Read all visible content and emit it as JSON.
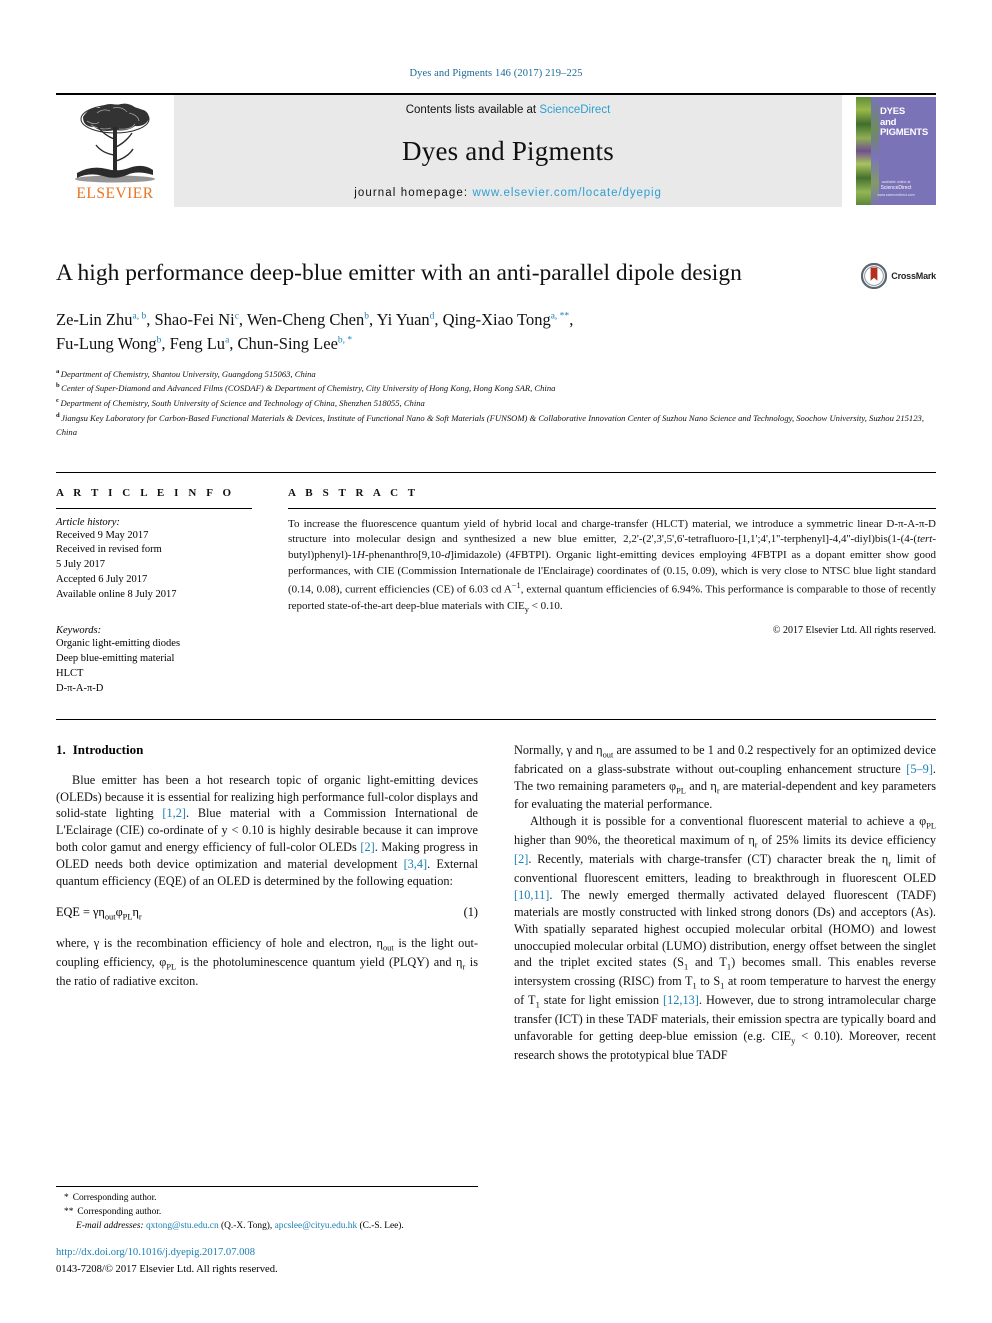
{
  "running_head": "Dyes and Pigments 146 (2017) 219–225",
  "masthead": {
    "publisher": "ELSEVIER",
    "contents_prefix": "Contents lists available at ",
    "contents_link": "ScienceDirect",
    "journal_title": "Dyes and Pigments",
    "homepage_prefix": "journal homepage: ",
    "homepage_url": "www.elsevier.com/locate/dyepig",
    "cover_title_line1": "DYES",
    "cover_title_line2": "and",
    "cover_title_line3": "PIGMENTS",
    "cover_footer_small": "available online at",
    "cover_footer_mark": "ScienceDirect",
    "cover_footer_url": "www.sciencedirect.com"
  },
  "article": {
    "title": "A high performance deep-blue emitter with an anti-parallel dipole design",
    "crossmark_label": "CrossMark"
  },
  "authors": {
    "line1": [
      {
        "name": "Ze-Lin Zhu",
        "marks": "a, b",
        "sep": ", "
      },
      {
        "name": "Shao-Fei Ni",
        "marks": "c",
        "sep": ", "
      },
      {
        "name": "Wen-Cheng Chen",
        "marks": "b",
        "sep": ", "
      },
      {
        "name": "Yi Yuan",
        "marks": "d",
        "sep": ", "
      },
      {
        "name": "Qing-Xiao Tong",
        "marks": "a, **",
        "sep": ","
      }
    ],
    "line2": [
      {
        "name": "Fu-Lung Wong",
        "marks": "b",
        "sep": ", "
      },
      {
        "name": "Feng Lu",
        "marks": "a",
        "sep": ", "
      },
      {
        "name": "Chun-Sing Lee",
        "marks": "b, *",
        "sep": ""
      }
    ]
  },
  "affiliations": [
    {
      "mark": "a",
      "text": "Department of Chemistry, Shantou University, Guangdong 515063, China"
    },
    {
      "mark": "b",
      "text": "Center of Super-Diamond and Advanced Films (COSDAF) & Department of Chemistry, City University of Hong Kong, Hong Kong SAR, China"
    },
    {
      "mark": "c",
      "text": "Department of Chemistry, South University of Science and Technology of China, Shenzhen 518055, China"
    },
    {
      "mark": "d",
      "text": "Jiangsu Key Laboratory for Carbon-Based Functional Materials & Devices, Institute of Functional Nano & Soft Materials (FUNSOM) & Collaborative Innovation Center of Suzhou Nano Science and Technology, Soochow University, Suzhou 215123, China"
    }
  ],
  "article_info": {
    "heading": "A R T I C L E   I N F O",
    "history_heading": "Article history:",
    "history": [
      "Received 9 May 2017",
      "Received in revised form",
      "5 July 2017",
      "Accepted 6 July 2017",
      "Available online 8 July 2017"
    ],
    "keywords_heading": "Keywords:",
    "keywords": [
      "Organic light-emitting diodes",
      "Deep blue-emitting material",
      "HLCT",
      "D-π-A-π-D"
    ]
  },
  "abstract": {
    "heading": "A B S T R A C T",
    "paragraph_1": "To increase the fluorescence quantum yield of hybrid local and charge-transfer (HLCT) material, we introduce a symmetric linear D-π-A-π-D structure into molecular design and synthesized a new blue emitter,",
    "chemical_name_1": "2,2'-(2',3',5',6'-tetrafluoro-[1,1';4',1''-terphenyl]-4,4''-diyl)bis(1-(4-(",
    "chemical_italic_1": "tert",
    "chemical_name_2": "-butyl)phenyl)-1",
    "chemical_italic_2": "H",
    "chemical_name_3": "-phenanthro[9,10-",
    "chemical_italic_3": "d",
    "chemical_name_4": "]imidazole) (4FBTPI).",
    "paragraph_2": "Organic light-emitting devices employing 4FBTPI as a dopant emitter show good performances, with CIE (Commission Internationale de l'Enclairage) coordinates of (0.15, 0.09), which is very close to NTSC blue light standard (0.14, 0.08), current efficiencies (CE) of 6.03 cd A",
    "paragraph_2_sup": "−1",
    "paragraph_3": ", external quantum efficiencies of 6.94%. This performance is comparable to those of recently reported state-of-the-art deep-blue materials with CIE",
    "paragraph_3_sub": "y",
    "paragraph_4": " < 0.10.",
    "copyright": "© 2017 Elsevier Ltd. All rights reserved."
  },
  "introduction": {
    "number": "1.",
    "title": "Introduction",
    "p1_a": "Blue emitter has been a hot research topic of organic light-emitting devices (OLEDs) because it is essential for realizing high performance full-color displays and solid-state lighting ",
    "p1_cite1": "[1,2]",
    "p1_b": ". Blue material with a Commission International de L'Eclairage (CIE) co-ordinate of y < 0.10 is highly desirable because it can improve both color gamut and energy efficiency of full-color OLEDs ",
    "p1_cite2": "[2]",
    "p1_c": ". Making progress in OLED needs both device optimization and material development ",
    "p1_cite3": "[3,4]",
    "p1_d": ". External quantum efficiency (EQE) of an OLED is determined by the following equation:",
    "equation": "EQE = γη",
    "equation_sub1": "out",
    "equation_b": "φ",
    "equation_sub2": "PL",
    "equation_c": "η",
    "equation_sub3": "r",
    "equation_number": "(1)",
    "p2_a": "where, γ is the recombination efficiency of hole and electron, η",
    "p2_sub1": "out",
    "p2_b": " is the light out-coupling efficiency, φ",
    "p2_sub2": "PL",
    "p2_c": " is the photoluminescence quantum yield (PLQY) and η",
    "p2_sub3": "r",
    "p2_d": " is the ratio of radiative exciton."
  },
  "right_column": {
    "p1_a": "Normally, γ and η",
    "p1_sub1": "out",
    "p1_b": " are assumed to be 1 and 0.2 respectively for an optimized device fabricated on a glass-substrate without out-coupling enhancement structure ",
    "p1_cite": "[5–9]",
    "p1_c": ". The two remaining parameters φ",
    "p1_sub2": "PL",
    "p1_d": " and η",
    "p1_sub3": "r",
    "p1_e": " are material-dependent and key parameters for evaluating the material performance.",
    "p2_a": "Although it is possible for a conventional fluorescent material to achieve a φ",
    "p2_sub1": "PL",
    "p2_b": " higher than 90%, the theoretical maximum of η",
    "p2_sub2": "r",
    "p2_c": " of 25% limits its device efficiency ",
    "p2_cite1": "[2]",
    "p2_d": ". Recently, materials with charge-transfer (CT) character break the η",
    "p2_sub3": "r",
    "p2_e": " limit of conventional fluorescent emitters, leading to breakthrough in fluorescent OLED ",
    "p2_cite2": "[10,11]",
    "p2_f": ". The newly emerged thermally activated delayed fluorescent (TADF) materials are mostly constructed with linked strong donors (Ds) and acceptors (As). With spatially separated highest occupied molecular orbital (HOMO) and lowest unoccupied molecular orbital (LUMO) distribution, energy offset between the singlet and the triplet excited states (S",
    "p2_sub4": "1",
    "p2_g": " and T",
    "p2_sub5": "1",
    "p2_h": ") becomes small. This enables reverse intersystem crossing (RISC) from T",
    "p2_sub6": "1",
    "p2_i": " to S",
    "p2_sub7": "1",
    "p2_j": " at room temperature to harvest the energy of T",
    "p2_sub8": "1",
    "p2_k": " state for light emission ",
    "p2_cite3": "[12,13]",
    "p2_l": ". However, due to strong intramolecular charge transfer (ICT) in these TADF materials, their emission spectra are typically board and unfavorable for getting deep-blue emission (e.g. CIE",
    "p2_sub9": "y",
    "p2_m": " < 0.10). Moreover, recent research shows the prototypical blue TADF"
  },
  "footnotes": {
    "corr1_mark": "*",
    "corr1_text": "Corresponding author.",
    "corr2_mark": "**",
    "corr2_text": "Corresponding author.",
    "email_label": "E-mail addresses:",
    "email1": "qxtong@stu.edu.cn",
    "email1_owner": "(Q.-X. Tong),",
    "email2": "apcslee@cityu.edu.hk",
    "email2_owner": "(C.-S. Lee).",
    "doi": "http://dx.doi.org/10.1016/j.dyepig.2017.07.008",
    "issn": "0143-7208/© 2017 Elsevier Ltd. All rights reserved."
  },
  "colors": {
    "link_blue": "#1a7fb5",
    "header_blue": "#1a6a94",
    "elsevier_orange": "#e87424",
    "cover_purple": "#7a73b8",
    "masthead_gray": "#e9e9e9"
  }
}
